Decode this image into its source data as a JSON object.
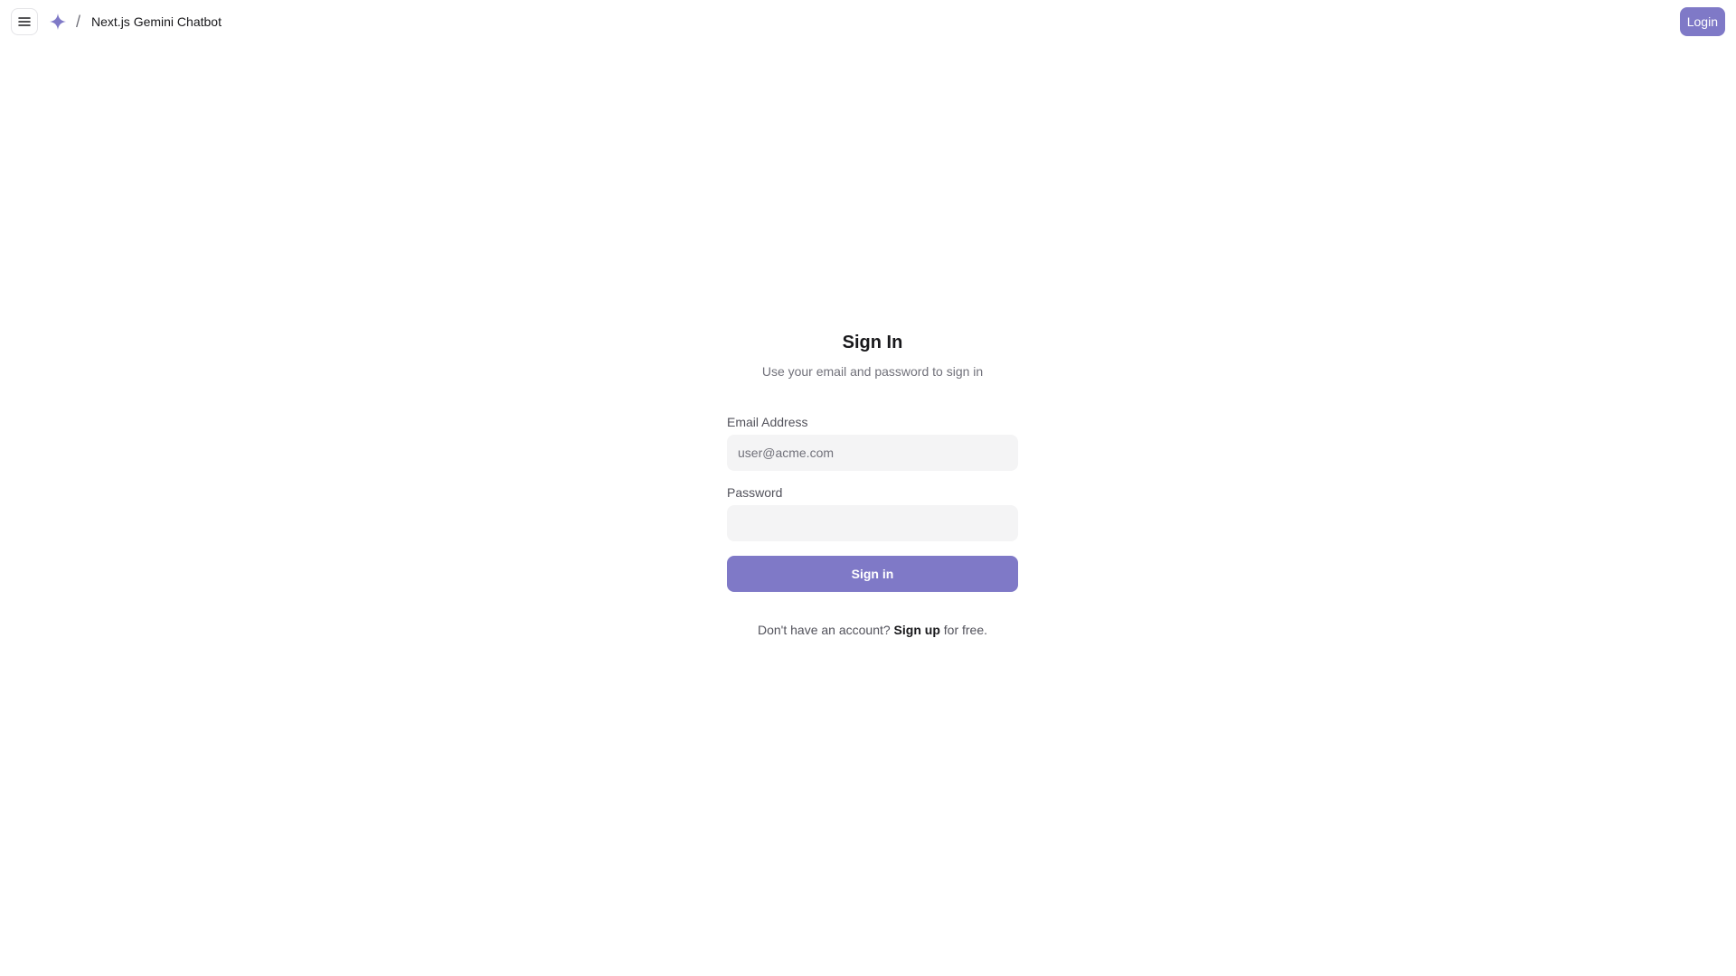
{
  "header": {
    "menu_icon": "hamburger-menu-icon",
    "brand_icon": "sparkle-icon",
    "separator": "/",
    "title": "Next.js Gemini Chatbot",
    "login_label": "Login"
  },
  "auth": {
    "title": "Sign In",
    "subtitle": "Use your email and password to sign in",
    "email_label": "Email Address",
    "email_placeholder": "user@acme.com",
    "email_value": "",
    "password_label": "Password",
    "password_value": "",
    "submit_label": "Sign in",
    "footer_prefix": "Don't have an account?",
    "signup_link": "Sign up",
    "footer_suffix": "for free."
  },
  "colors": {
    "accent": "#7f79c7",
    "input_bg": "#f4f4f5",
    "muted_text": "#71717a"
  }
}
